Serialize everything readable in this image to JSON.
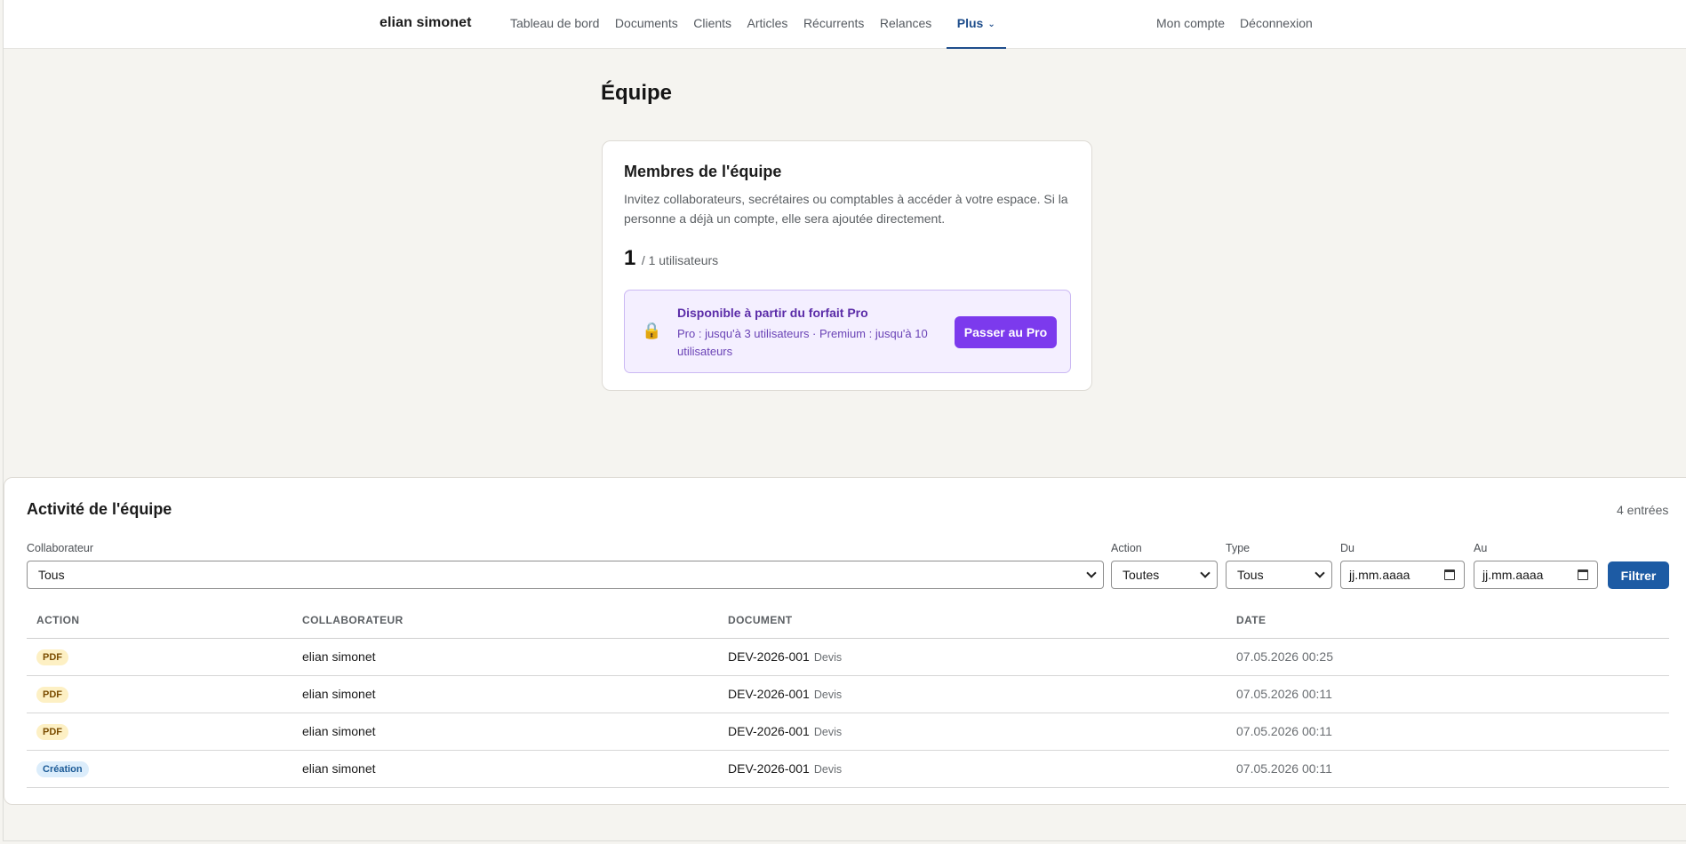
{
  "nav": {
    "brand": "elian simonet",
    "links": [
      "Tableau de bord",
      "Documents",
      "Clients",
      "Articles",
      "Récurrents",
      "Relances"
    ],
    "more_label": "Plus",
    "account_links": [
      "Mon compte",
      "Déconnexion"
    ],
    "accent_color": "#1f4e8c"
  },
  "page": {
    "title": "Équipe"
  },
  "team_card": {
    "title": "Membres de l'équipe",
    "description": "Invitez collaborateurs, secrétaires ou comptables à accéder à votre espace. Si la personne a déjà un compte, elle sera ajoutée directement.",
    "count": "1",
    "count_label": "/ 1 utilisateurs",
    "upsell": {
      "icon": "lock-icon",
      "icon_glyph": "🔒",
      "title": "Disponible à partir du forfait Pro",
      "description": "Pro : jusqu'à 3 utilisateurs · Premium : jusqu'à 10 utilisateurs",
      "button_label": "Passer au Pro",
      "button_color": "#7c3aed"
    }
  },
  "activity": {
    "title": "Activité de l'équipe",
    "entries_label": "4 entrées",
    "filters": {
      "collaborator_label": "Collaborateur",
      "collaborator_value": "Tous",
      "action_label": "Action",
      "action_value": "Toutes",
      "type_label": "Type",
      "type_value": "Tous",
      "from_label": "Du",
      "from_placeholder": "jj.mm.aaaa",
      "to_label": "Au",
      "to_placeholder": "jj.mm.aaaa",
      "filter_button": "Filtrer"
    },
    "columns": [
      "ACTION",
      "COLLABORATEUR",
      "DOCUMENT",
      "DATE"
    ],
    "rows": [
      {
        "action": "PDF",
        "kind": "pdf",
        "collaborator": "elian simonet",
        "document": "DEV-2026-001",
        "doc_type": "Devis",
        "date": "07.05.2026 00:25"
      },
      {
        "action": "PDF",
        "kind": "pdf",
        "collaborator": "elian simonet",
        "document": "DEV-2026-001",
        "doc_type": "Devis",
        "date": "07.05.2026 00:11"
      },
      {
        "action": "PDF",
        "kind": "pdf",
        "collaborator": "elian simonet",
        "document": "DEV-2026-001",
        "doc_type": "Devis",
        "date": "07.05.2026 00:11"
      },
      {
        "action": "Création",
        "kind": "create",
        "collaborator": "elian simonet",
        "document": "DEV-2026-001",
        "doc_type": "Devis",
        "date": "07.05.2026 00:11"
      }
    ]
  }
}
